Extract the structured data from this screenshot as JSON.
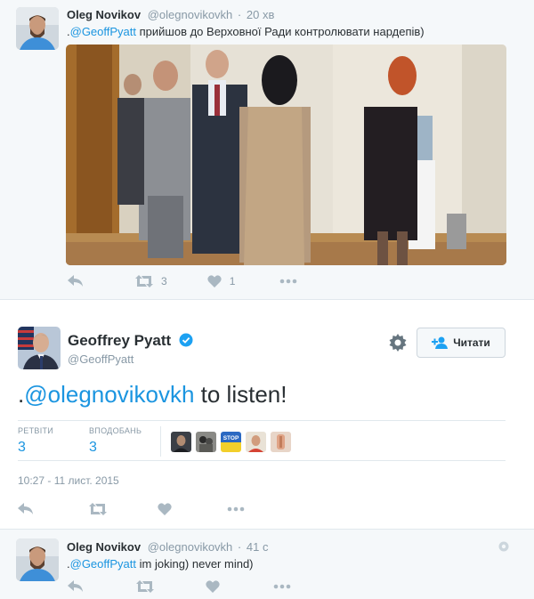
{
  "tweet1": {
    "name": "Oleg Novikov",
    "handle": "@olegnovikovkh",
    "sep": "·",
    "time": "20 хв",
    "text_prefix": ".",
    "mention": "@GeoffPyatt",
    "text_rest": " прийшов до Верховної Ради контролювати нардепів)",
    "retweets": "3",
    "likes": "1"
  },
  "main_tweet": {
    "name": "Geoffrey Pyatt",
    "handle": "@GeoffPyatt",
    "follow_label": "Читати",
    "text_prefix": ".",
    "mention": "@olegnovikovkh",
    "text_rest": " to listen!",
    "retweets_label": "РЕТВІТИ",
    "retweets": "3",
    "likes_label": "ВПОДОБАНЬ",
    "likes": "3",
    "timestamp": "10:27 - 11 лист. 2015",
    "liker_stop_text": "STOP"
  },
  "tweet3": {
    "name": "Oleg Novikov",
    "handle": "@olegnovikovkh",
    "sep": "·",
    "time": "41 с",
    "text_prefix": ".",
    "mention": "@GeoffPyatt",
    "text_rest": " im joking) never mind)"
  },
  "icons": [
    "reply-icon",
    "retweet-icon",
    "heart-icon",
    "more-icon",
    "verified-icon",
    "gear-icon",
    "follow-icon",
    "caret-icon"
  ],
  "colors": {
    "link": "#1b95e0",
    "muted": "#8899a6",
    "verified": "#1da1f2",
    "bg_light": "#f5f8fa"
  }
}
